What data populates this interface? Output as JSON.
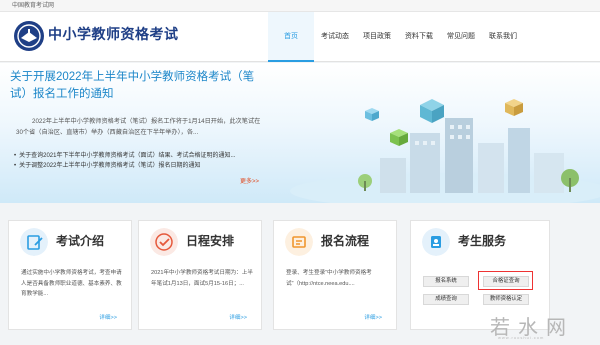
{
  "topbar": {
    "text": "中国教育考试网"
  },
  "header": {
    "title": "中小学教师资格考试",
    "logo_icon": "edu-logo-icon"
  },
  "nav": {
    "items": [
      {
        "label": "首页",
        "active": true
      },
      {
        "label": "考试动态",
        "active": false
      },
      {
        "label": "项目政策",
        "active": false
      },
      {
        "label": "资料下载",
        "active": false
      },
      {
        "label": "常见问题",
        "active": false
      },
      {
        "label": "联系我们",
        "active": false
      }
    ]
  },
  "banner": {
    "title": "关于开展2022年上半年中小学教师资格考试（笔试）报名工作的通知",
    "body": "2022年上半年中小学教师资格考试（笔试）报名工作将于1月14日开始，此次笔试在30个省（自治区、直辖市）举办（西藏自治区在下半年举办），各...",
    "news": [
      "关于查询2021年下半年中小学教师资格考试（面试）结果、考试合格证明的通知...",
      "关于调整2022年上半年中小学教师资格考试（笔试）报名日期的通知"
    ],
    "more": "更多>>"
  },
  "cards": {
    "intro": {
      "title": "考试介绍",
      "text": "通过实施中小学教师资格考试，考查申请人是否具备教师职业道德、基本素养、教育教学能...",
      "more": "详细>>"
    },
    "schedule": {
      "title": "日程安排",
      "text": "2021年中小学教师资格考试日期为：上半年笔试1月13日，面试5月15-16日；...",
      "more": "详细>>"
    },
    "process": {
      "title": "报名流程",
      "text": "登录、考生登录“中小学教师资格考试”（http://ntce.neea.edu....",
      "more": "详细>>"
    },
    "service": {
      "title": "考生服务",
      "buttons": [
        "报名系统",
        "合格证查询",
        "成绩查询",
        "教师资格认定"
      ]
    }
  },
  "watermark": {
    "text": "若水网",
    "sub": "www.ruoshui.com"
  },
  "colors": {
    "brand": "#1f3f86",
    "accent": "#2a9de2",
    "highlight": "#e33333",
    "more_link": "#e04a20"
  }
}
